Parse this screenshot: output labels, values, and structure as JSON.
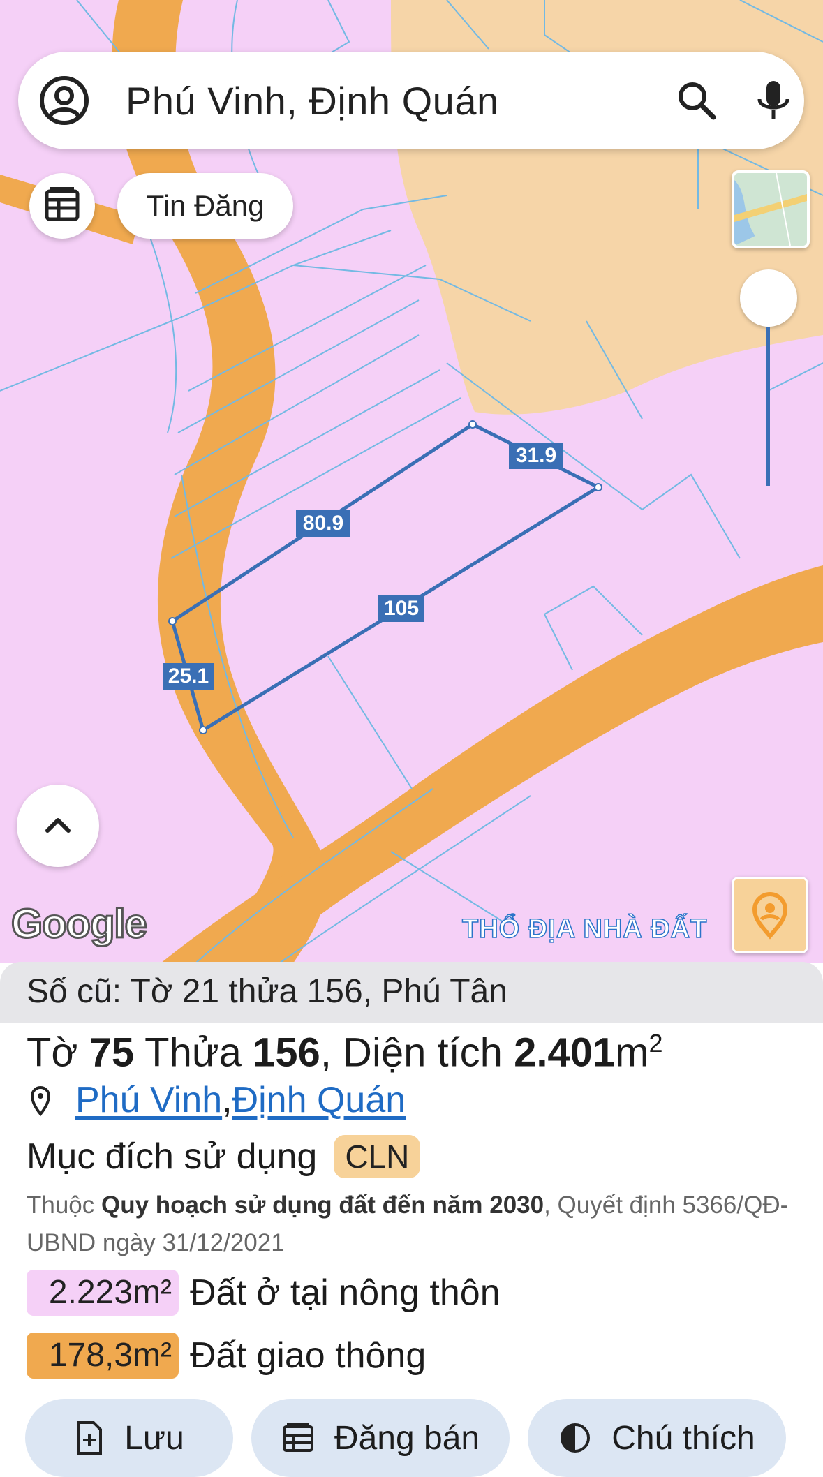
{
  "search": {
    "query": "Phú Vinh, Định Quán"
  },
  "map": {
    "chip_label": "Tin Đăng",
    "watermark": "THỔ ĐỊA NHÀ ĐẤT",
    "google_logo": "Google",
    "colors": {
      "residential": "#f5d0f7",
      "perennial": "#f6d5a8",
      "road": "#f0a94f",
      "boundary": "#3a6fb5",
      "lot_lines": "#73b9e3"
    },
    "edge_lengths": [
      "80.9",
      "31.9",
      "105",
      "25.1"
    ]
  },
  "parcel": {
    "old_number": "Số cũ: Tờ 21 thửa 156, Phú Tân",
    "to_prefix": "Tờ ",
    "to_number": "75",
    "thua_prefix": " Thửa ",
    "thua_number": "156",
    "area_prefix": ", Diện tích ",
    "area_value": "2.401",
    "area_unit": "m",
    "area_sup": "2",
    "commune": "Phú Vinh",
    "separator": ", ",
    "district": "Định Quán",
    "usage_label": "Mục đích sử dụng",
    "usage_code": "CLN",
    "planning_prefix": "Thuộc ",
    "planning_name": "Quy hoạch sử dụng đất đến năm 2030",
    "planning_suffix": ", Quyết định 5366/QĐ-UBND ngày 31/12/2021"
  },
  "land_use": [
    {
      "area": "2.223m²",
      "label": "Đất ở tại nông thôn",
      "color": "#f5d0f7"
    },
    {
      "area": "178,3m²",
      "label": "Đất giao thông",
      "color": "#f0a94f"
    }
  ],
  "actions": {
    "save": "Lưu",
    "post": "Đăng bán",
    "legend": "Chú thích"
  }
}
